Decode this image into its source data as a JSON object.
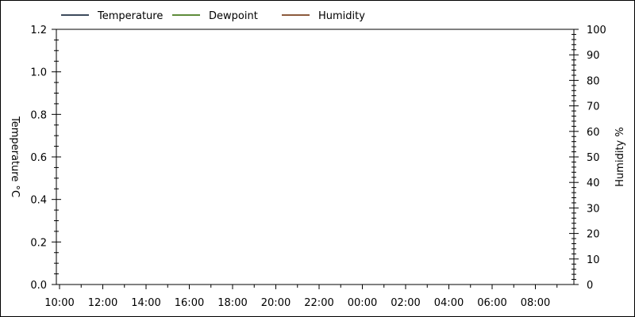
{
  "chart_data": {
    "type": "line",
    "legend": {
      "placement": "top-left",
      "entries": [
        {
          "name": "Temperature",
          "color": "#3c4a5c"
        },
        {
          "name": "Dewpoint",
          "color": "#5e8c3a"
        },
        {
          "name": "Humidity",
          "color": "#8c5a3c"
        }
      ]
    },
    "x_axis": {
      "ticks": [
        "10:00",
        "12:00",
        "14:00",
        "16:00",
        "18:00",
        "20:00",
        "22:00",
        "00:00",
        "02:00",
        "04:00",
        "06:00",
        "08:00"
      ]
    },
    "y_left": {
      "label": "Temperature °C",
      "range": [
        0,
        1.2
      ],
      "ticks": [
        "0.0",
        "0.2",
        "0.4",
        "0.6",
        "0.8",
        "1.0",
        "1.2"
      ]
    },
    "y_right": {
      "label": "Humidity %",
      "range": [
        0,
        100
      ],
      "ticks": [
        "0",
        "10",
        "20",
        "30",
        "40",
        "50",
        "60",
        "70",
        "80",
        "90",
        "100"
      ]
    },
    "grid": false,
    "series": [
      {
        "name": "Temperature",
        "values": []
      },
      {
        "name": "Dewpoint",
        "values": []
      },
      {
        "name": "Humidity",
        "values": []
      }
    ]
  }
}
